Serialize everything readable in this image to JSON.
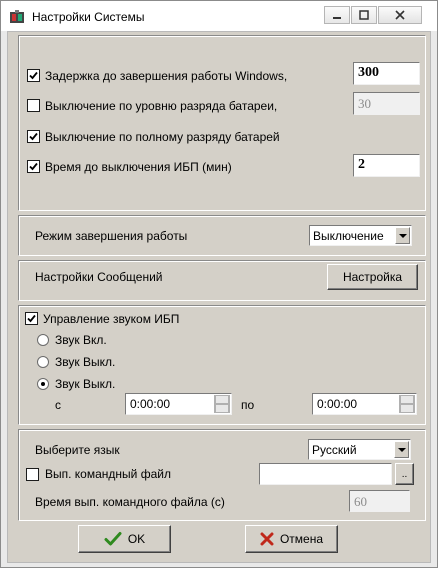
{
  "window": {
    "title": "Настройки Системы"
  },
  "titlebar": {
    "minimize_icon": "minimize-icon",
    "maximize_icon": "maximize-icon",
    "close_icon": "close-icon"
  },
  "shutdown": {
    "delay": {
      "label": "Задержка до завершения работы Windows,",
      "checked": true,
      "value": "300"
    },
    "battery_level": {
      "label": "Выключение по уровню разряда батареи,",
      "checked": false,
      "value": "30"
    },
    "battery_full": {
      "label": "Выключение по полному разряду батарей",
      "checked": true
    },
    "ups_time": {
      "label": "Время до выключения ИБП (мин)",
      "checked": true,
      "value": "2"
    }
  },
  "mode": {
    "label": "Режим завершения работы",
    "selected": "Выключение"
  },
  "messages": {
    "label": "Настройки Сообщений",
    "button": "Настройка"
  },
  "sound": {
    "label": "Управление звуком ИБП",
    "checked": true,
    "options": [
      {
        "label": "Звук Вкл.",
        "selected": false
      },
      {
        "label": "Звук Выкл.",
        "selected": false
      },
      {
        "label": "Звук Выкл.",
        "selected": true
      }
    ],
    "from_label": "с",
    "from_value": "0:00:00",
    "to_label": "по",
    "to_value": "0:00:00"
  },
  "language": {
    "label": "Выберите язык",
    "selected": "Русский"
  },
  "command": {
    "label": "Вып. командный файл",
    "checked": false,
    "path": "",
    "browse": "..",
    "time_label": "Время вып. командного файла (с)",
    "time_value": "60"
  },
  "buttons": {
    "ok": "OK",
    "cancel": "Отмена"
  },
  "colors": {
    "panel": "#d4d0c8",
    "ok_check": "#2f8a1f",
    "cancel_x": "#c0281b"
  }
}
